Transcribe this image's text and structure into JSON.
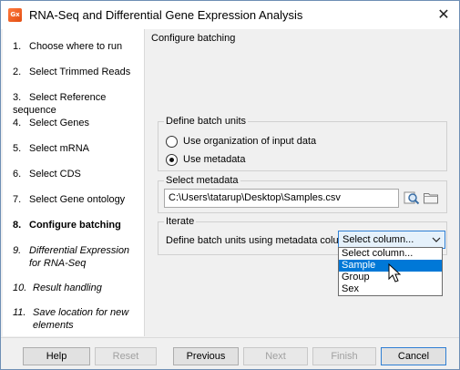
{
  "window": {
    "title": "RNA-Seq and Differential Gene Expression Analysis",
    "icon_text": "Gx",
    "close_label": "✕"
  },
  "steps": [
    {
      "num": "1.",
      "label": "Choose where to run"
    },
    {
      "num": "2.",
      "label": "Select Trimmed Reads"
    },
    {
      "num": "3.",
      "label": "Select Reference sequence"
    },
    {
      "num": "4.",
      "label": "Select Genes"
    },
    {
      "num": "5.",
      "label": "Select mRNA"
    },
    {
      "num": "6.",
      "label": "Select CDS"
    },
    {
      "num": "7.",
      "label": "Select Gene ontology"
    },
    {
      "num": "8.",
      "label": "Configure batching"
    },
    {
      "num": "9.",
      "label_line1": "Differential Expression",
      "label_line2": "for RNA-Seq"
    },
    {
      "num": "10.",
      "label": "Result handling"
    },
    {
      "num": "11.",
      "label_line1": "Save location for new",
      "label_line2": "elements"
    }
  ],
  "content": {
    "title": "Configure batching",
    "batch_units": {
      "legend": "Define batch units",
      "option1": "Use organization of input data",
      "option2": "Use metadata",
      "selected": "Use metadata"
    },
    "metadata": {
      "legend": "Select metadata",
      "path": "C:\\Users\\tatarup\\Desktop\\Samples.csv",
      "browse_icon": "search-icon",
      "folder_icon": "folder-icon"
    },
    "iterate": {
      "legend": "Iterate",
      "label": "Define batch units using metadata column",
      "select_value": "Select column...",
      "options": [
        "Select column...",
        "Sample",
        "Group",
        "Sex"
      ],
      "highlighted": "Sample"
    }
  },
  "buttons": {
    "help": "Help",
    "reset": "Reset",
    "previous": "Previous",
    "next": "Next",
    "finish": "Finish",
    "cancel": "Cancel"
  },
  "colors": {
    "accent": "#0078d7",
    "app_icon": "#e24d12"
  }
}
